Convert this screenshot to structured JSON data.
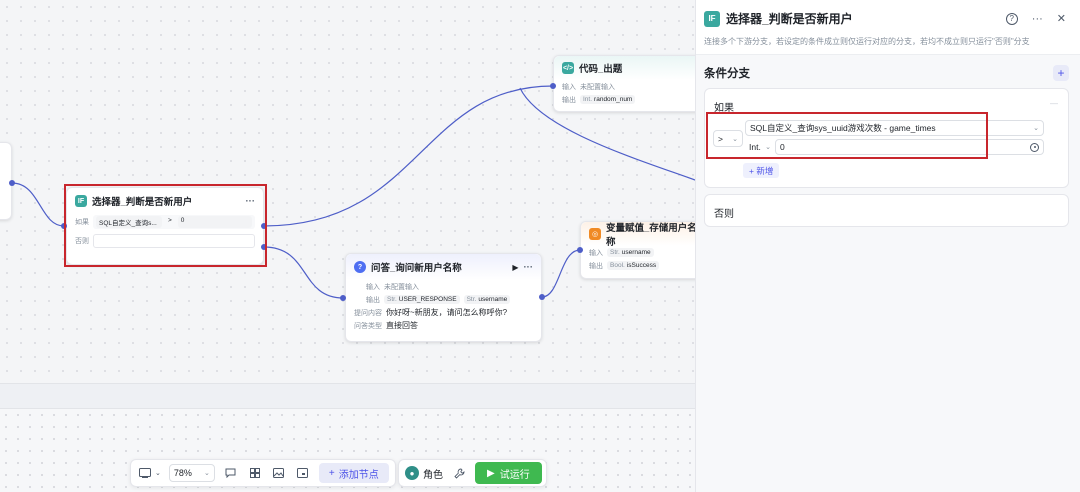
{
  "colors": {
    "accent": "#4d53e8",
    "edge": "#4e5ec8",
    "highlight": "#c8262d",
    "run": "#3fb950",
    "if_icon": "#3aa89f",
    "code_icon": "#3aa89f",
    "qa_icon": "#4e6ef2",
    "var_icon": "#f08a24"
  },
  "nodes": {
    "selector": {
      "icon": "IF",
      "title": "选择器_判断是否新用户",
      "menu": "···",
      "if_label": "如果",
      "condition_var": "SQL自定义_查询s...",
      "operator": ">",
      "value": "0",
      "else_label": "否则"
    },
    "code": {
      "icon": "</>",
      "title": "代码_出题",
      "input_label": "输入",
      "input_value": "未配置输入",
      "output_label": "输出",
      "output_type": "Int.",
      "output_name": "random_num"
    },
    "qa": {
      "icon": "?",
      "title": "问答_询问新用户名称",
      "play": "▶",
      "menu": "···",
      "input_label": "输入",
      "input_value": "未配置输入",
      "output_label": "输出",
      "out1_type": "Str.",
      "out1_name": "USER_RESPONSE",
      "out2_type": "Str.",
      "out2_name": "username",
      "question_label": "提问内容",
      "question_value": "你好呀~新朋友，请问怎么称呼你?",
      "answer_type_label": "问答类型",
      "answer_type_value": "直接回答"
    },
    "var": {
      "icon": "◎",
      "title": "变量赋值_存储用户名称",
      "input_label": "输入",
      "in_type": "Str.",
      "in_name": "username",
      "output_label": "输出",
      "out_type": "Bool.",
      "out_name": "isSuccess"
    }
  },
  "panel": {
    "icon": "IF",
    "title": "选择器_判断是否新用户",
    "description": "连接多个下游分支，若设定的条件成立则仅运行对应的分支，若均不成立则只运行\"否则\"分支",
    "help_icon": "?",
    "more_icon": "···",
    "close_icon": "✕",
    "section_title": "条件分支",
    "add_icon": "+",
    "branch_if": {
      "label": "如果",
      "collapse": "—",
      "operator": ">",
      "variable": "SQL自定义_查询sys_uuid游戏次数 - game_times",
      "value_type": "Int.",
      "value": "0",
      "add_label": "+ 新增"
    },
    "branch_else": {
      "label": "否则"
    }
  },
  "toolbar": {
    "zoom": "78%",
    "add_node_label": "添加节点",
    "role_label": "角色",
    "role_avatar": "●",
    "run_label": "试运行"
  }
}
